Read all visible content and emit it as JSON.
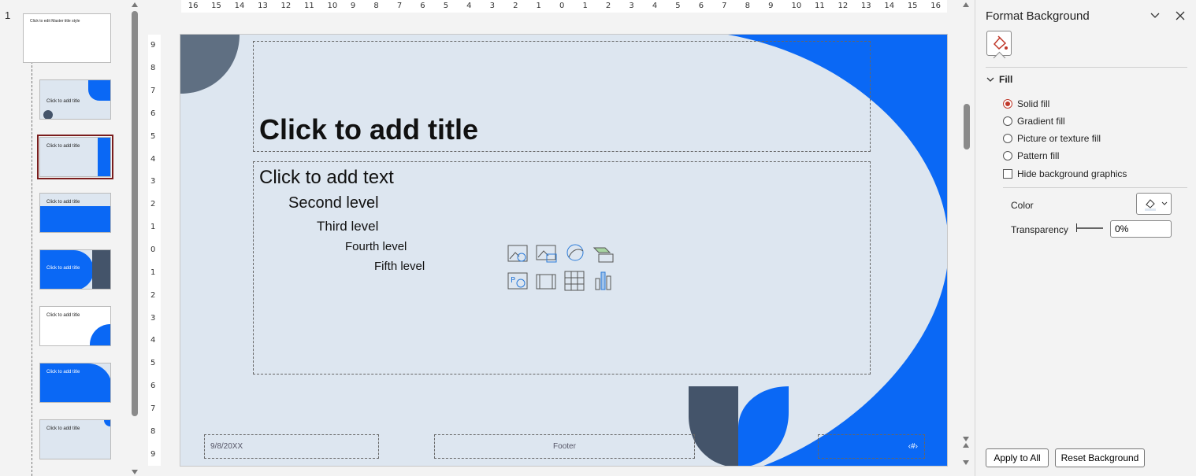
{
  "thumbnails": {
    "slide_number": "1",
    "master_title": "Click to edit Master title style",
    "layout_title": "Click to add title"
  },
  "slide": {
    "title": "Click to add title",
    "levels": [
      "Click to add text",
      "Second level",
      "Third level",
      "Fourth level",
      "Fifth level"
    ],
    "date": "9/8/20XX",
    "footer": "Footer",
    "slide_number": "‹#›"
  },
  "ruler": {
    "horizontal": [
      "16",
      "15",
      "14",
      "13",
      "12",
      "11",
      "10",
      "9",
      "8",
      "7",
      "6",
      "5",
      "4",
      "3",
      "2",
      "1",
      "0",
      "1",
      "2",
      "3",
      "4",
      "5",
      "6",
      "7",
      "8",
      "9",
      "10",
      "11",
      "12",
      "13",
      "14",
      "15",
      "16"
    ],
    "vertical": [
      "9",
      "8",
      "7",
      "6",
      "5",
      "4",
      "3",
      "2",
      "1",
      "0",
      "1",
      "2",
      "3",
      "4",
      "5",
      "6",
      "7",
      "8",
      "9"
    ]
  },
  "pane": {
    "title": "Format Background",
    "fill_section": "Fill",
    "options": [
      "Solid fill",
      "Gradient fill",
      "Picture or texture fill",
      "Pattern fill"
    ],
    "hide_bg": "Hide background graphics",
    "color_label": "Color",
    "transparency_label": "Transparency",
    "transparency_value": "0%",
    "apply_all": "Apply to All",
    "reset": "Reset Background"
  },
  "colors": {
    "accent_blue": "#0a68f5",
    "dark_slate": "#44546a",
    "slide_bg": "#dde6f0",
    "selected_outline": "#7a1d1d",
    "radio_on": "#c0392b"
  }
}
